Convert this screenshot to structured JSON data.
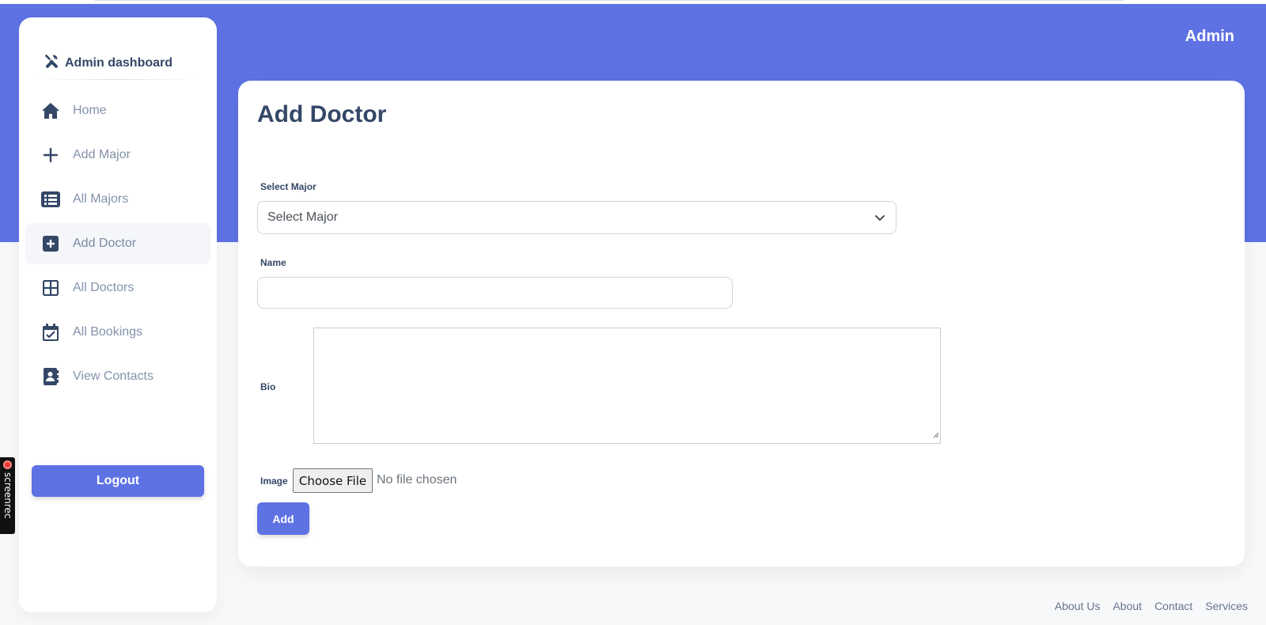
{
  "header": {
    "user_label": "Admin"
  },
  "sidebar": {
    "brand": "Admin dashboard",
    "items": [
      {
        "label": "Home",
        "icon": "home-icon"
      },
      {
        "label": "Add Major",
        "icon": "plus-icon"
      },
      {
        "label": "All Majors",
        "icon": "list-icon"
      },
      {
        "label": "Add Doctor",
        "icon": "plus-square-icon",
        "active": true
      },
      {
        "label": "All Doctors",
        "icon": "grid-icon"
      },
      {
        "label": "All Bookings",
        "icon": "calendar-check-icon"
      },
      {
        "label": "View Contacts",
        "icon": "contact-book-icon"
      }
    ],
    "logout_label": "Logout"
  },
  "form": {
    "title": "Add Doctor",
    "major_label": "Select Major",
    "major_selected": "Select Major",
    "name_label": "Name",
    "name_value": "",
    "bio_label": "Bio",
    "bio_value": "",
    "image_label": "Image",
    "file_button": "Choose File",
    "file_status": "No file chosen",
    "submit_label": "Add"
  },
  "footer": {
    "links": [
      "About Us",
      "About",
      "Contact",
      "Services"
    ]
  },
  "overlay": {
    "recorder_label": "screenrec"
  },
  "colors": {
    "accent": "#5e72e4",
    "text": "#344767",
    "muted": "#8392ab"
  }
}
